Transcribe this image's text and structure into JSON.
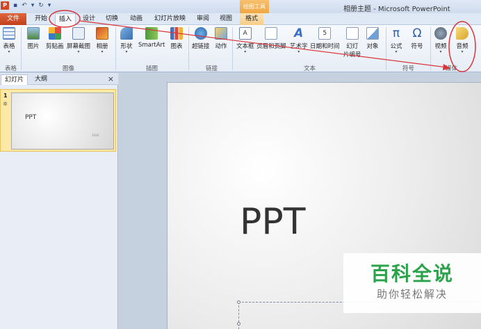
{
  "titlebar": {
    "app_icon": "P",
    "tool_group": "绘图工具",
    "window_title": "相册主题 - Microsoft PowerPoint"
  },
  "tabs": {
    "file": "文件",
    "home": "开始",
    "insert": "插入",
    "design": "设计",
    "transitions": "切换",
    "animations": "动画",
    "slideshow": "幻灯片放映",
    "review": "审阅",
    "view": "视图",
    "format": "格式"
  },
  "ribbon": {
    "table": "表格",
    "picture": "图片",
    "clipart": "剪贴画",
    "screenshot": "屏幕截图",
    "album": "相册",
    "shapes": "形状",
    "smartart": "SmartArt",
    "chart": "图表",
    "hyperlink": "超链接",
    "action": "动作",
    "textbox": "文本框",
    "header_footer": "页眉和页脚",
    "wordart": "艺术字",
    "datetime": "日期和时间",
    "slidenum_1": "幻灯",
    "slidenum_2": "片编号",
    "object": "对象",
    "equation": "公式",
    "symbol": "符号",
    "video": "视频",
    "audio": "音频"
  },
  "groups": {
    "tables": "表格",
    "images": "图像",
    "illustrations": "插图",
    "links": "链接",
    "text": "文本",
    "symbols": "符号",
    "media": "媒体"
  },
  "panel": {
    "tab_slides": "幻灯片",
    "tab_outline": "大纲",
    "close": "×",
    "slide_number": "1",
    "thumb_title": "PPT",
    "thumb_sub": "2016"
  },
  "slide": {
    "title": "PPT"
  },
  "watermark": {
    "title": "百科全说",
    "subtitle": "助你轻松解决"
  },
  "colors": {
    "file_tab": "#d24726",
    "annotation": "#d9343a",
    "watermark_green": "#2aa34a"
  }
}
